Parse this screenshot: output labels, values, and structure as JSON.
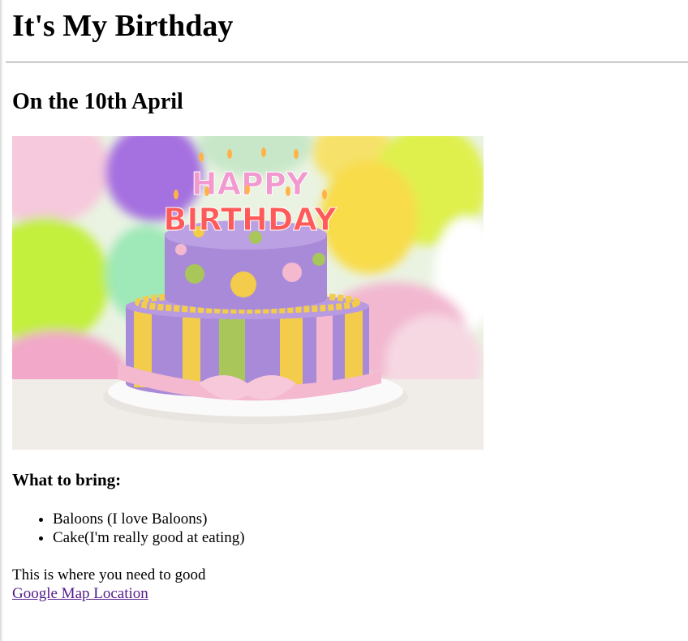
{
  "page": {
    "title": "It's My Birthday",
    "date_heading": "On the 10th April",
    "bring_heading": "What to bring:",
    "bring_items": [
      "Baloons (I love Baloons)",
      "Cake(I'm really good at eating)"
    ],
    "location_text": "This is where you need to good",
    "map_link_label": "Google Map Location"
  },
  "photo": {
    "topper_line1": "HAPPY",
    "topper_line2": "BIRTHDAY"
  },
  "colors": {
    "link_visited": "#551a8b",
    "cake_purple": "#a98ad8",
    "cake_pink": "#f4b8cf",
    "cake_yellow": "#f2cc4a",
    "cake_green": "#a8c65a"
  }
}
